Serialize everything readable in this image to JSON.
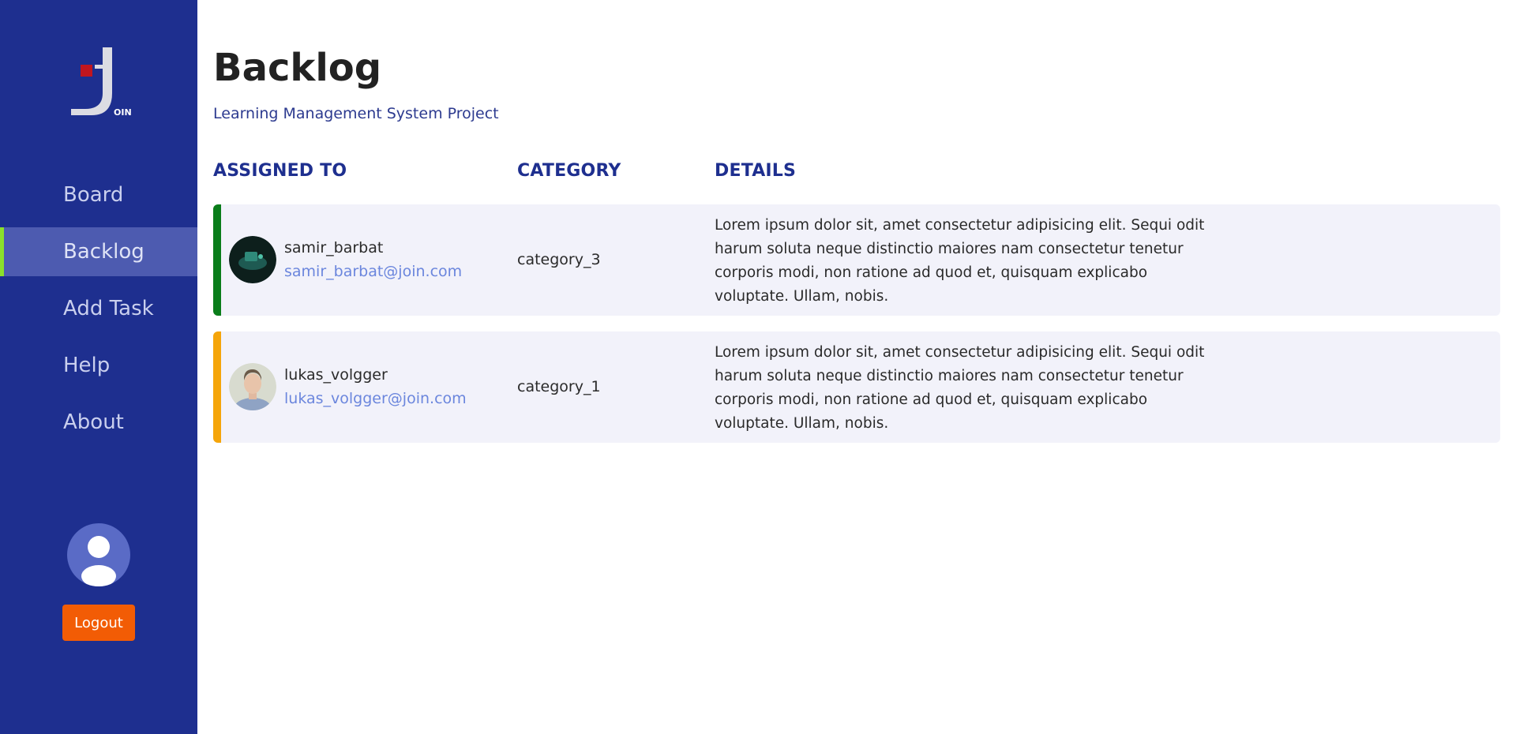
{
  "sidebar": {
    "logo_text": "OIN",
    "nav": [
      {
        "label": "Board",
        "active": false
      },
      {
        "label": "Backlog",
        "active": true
      },
      {
        "label": "Add Task",
        "active": false
      },
      {
        "label": "Help",
        "active": false
      },
      {
        "label": "About",
        "active": false
      }
    ],
    "logout_label": "Logout",
    "user_icon": "user-silhouette-icon"
  },
  "header": {
    "title": "Backlog",
    "subtitle": "Learning Management System Project"
  },
  "table": {
    "columns": [
      "ASSIGNED TO",
      "CATEGORY",
      "DETAILS"
    ],
    "rows": [
      {
        "username": "samir_barbat",
        "email": "samir_barbat@join.com",
        "category": "category_3",
        "details": "Lorem ipsum dolor sit, amet consectetur adipisicing elit. Sequi odit harum soluta neque distinctio maiores nam consectetur tenetur corporis modi, non ratione ad quod et, quisquam explicabo voluptate. Ullam, nobis.",
        "stripe_color": "#0a7d1a"
      },
      {
        "username": "lukas_volgger",
        "email": "lukas_volgger@join.com",
        "category": "category_1",
        "details": "Lorem ipsum dolor sit, amet consectetur adipisicing elit. Sequi odit harum soluta neque distinctio maiores nam consectetur tenetur corporis modi, non ratione ad quod et, quisquam explicabo voluptate. Ullam, nobis.",
        "stripe_color": "#f5a50a"
      }
    ]
  },
  "colors": {
    "sidebar_bg": "#1e2f8f",
    "active_item_bg": "#4d5bb0",
    "active_indicator": "#8ae02a",
    "logout_bg": "#f25c05",
    "heading_blue": "#1e2f8f",
    "row_bg": "#f2f2fa",
    "email_link": "#6b86dd"
  }
}
